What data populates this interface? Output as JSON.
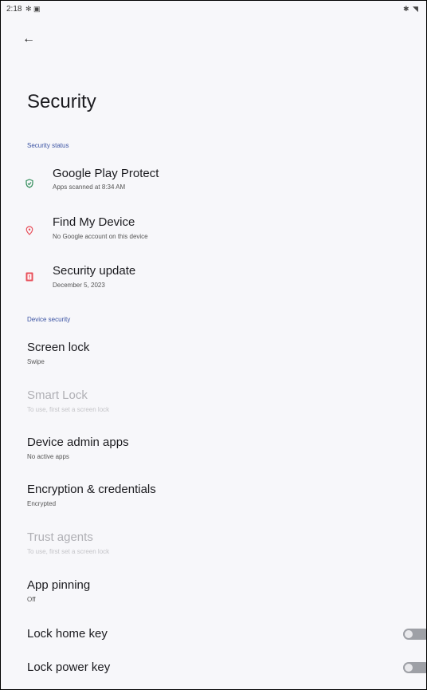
{
  "status_bar": {
    "time": "2:18",
    "left_icons": [
      "settings-gear-icon",
      "notification-icon"
    ],
    "right_icons": [
      "bluetooth-icon",
      "wifi-icon"
    ]
  },
  "page": {
    "title": "Security"
  },
  "sections": {
    "security_status": {
      "header": "Security status",
      "items": [
        {
          "label": "Google Play Protect",
          "sub": "Apps scanned at 8:34 AM",
          "icon": "shield-check-icon",
          "color": "#2e8b57"
        },
        {
          "label": "Find My Device",
          "sub": "No Google account on this device",
          "icon": "location-pin-icon",
          "color": "#e8505b"
        },
        {
          "label": "Security update",
          "sub": "December 5, 2023",
          "icon": "security-update-icon",
          "color": "#e8505b"
        }
      ]
    },
    "device_security": {
      "header": "Device security",
      "items": [
        {
          "label": "Screen lock",
          "sub": "Swipe",
          "enabled": true
        },
        {
          "label": "Smart Lock",
          "sub": "To use, first set a screen lock",
          "enabled": false
        },
        {
          "label": "Device admin apps",
          "sub": "No active apps",
          "enabled": true
        },
        {
          "label": "Encryption & credentials",
          "sub": "Encrypted",
          "enabled": true
        },
        {
          "label": "Trust agents",
          "sub": "To use, first set a screen lock",
          "enabled": false
        },
        {
          "label": "App pinning",
          "sub": "Off",
          "enabled": true
        }
      ]
    },
    "toggles": [
      {
        "label": "Lock home key",
        "checked": false
      },
      {
        "label": "Lock power key",
        "checked": false
      }
    ]
  }
}
